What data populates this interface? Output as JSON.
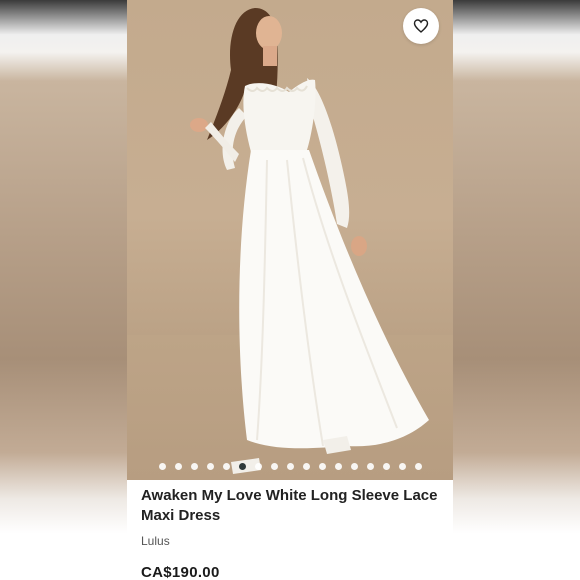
{
  "product": {
    "title": "Awaken My Love White Long Sleeve Lace Maxi Dress",
    "brand": "Lulus",
    "price": "CA$190.00"
  },
  "carousel": {
    "count": 17,
    "active_index": 5
  },
  "icons": {
    "like": "heart-icon"
  },
  "colors": {
    "photo_background": "#c3aa8d",
    "dress": "#ffffff",
    "active_dot": "#2f3a3a",
    "text": "#222222"
  }
}
